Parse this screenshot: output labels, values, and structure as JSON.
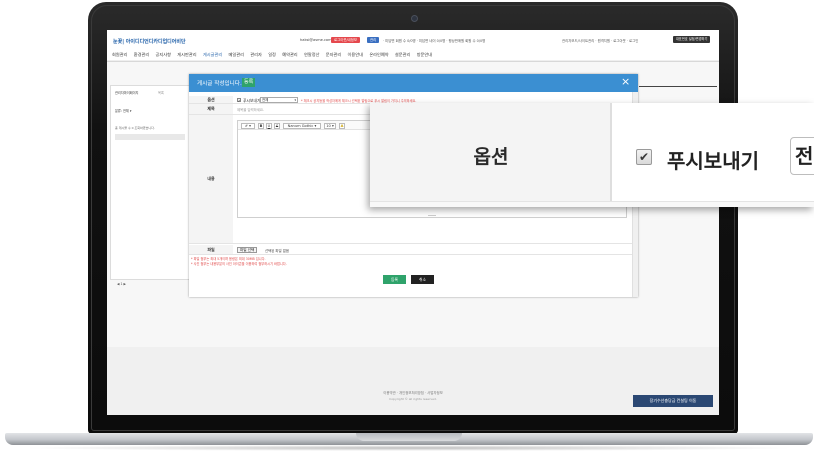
{
  "header": {
    "logo": "눈꽃| 아이디디언디카디업디어비단",
    "user_info": "haksi@asme.com",
    "logout_label": "로그아웃/내정보",
    "mode_label": "관리",
    "stats": "· 미답변 회원 수 0/0명 · 미답변 네이 0/0명 · 평상판매원 회원 수 0/0명",
    "util_links": "관리자모드/사이트관리 · 원격지원 · 로그아웃 · 로그인",
    "shortcut_label": "대표번호 설정/변경하기"
  },
  "nav": {
    "items": [
      "회원관리",
      "환경관리",
      "공지사항",
      "게시판관리",
      "게시글관리",
      "메일관리",
      "관리자",
      "일정",
      "예약관리",
      "연말정산",
      "문자관리",
      "이용안내",
      "온라인예약",
      "설문관리",
      "방문안내"
    ],
    "active_index": 4
  },
  "left_panel": {
    "tab1": "관리자마이페이지",
    "tab2": "목록",
    "select": "분류: 전체  ▾",
    "info": "총 게시물 수 0 조회하였습니다.",
    "pager": "◀ 1 ▶"
  },
  "modal": {
    "title": "게시글 작성입니다.",
    "badge": "등록",
    "close_icon": "×",
    "option_label": "옵션",
    "option_checkbox_label": "푸시보내기",
    "option_select_value": "전체",
    "option_notice": "* 체크시 공지등을 작성자에게 체크시 선택된 알림으로 푸시 알림이 가지니 주의하세요.",
    "title_label": "제목",
    "title_placeholder": "제목을 입력하세요.",
    "content_label": "내용",
    "toolbar": {
      "pen": "✐ ▾",
      "bold": "B",
      "underline": "U",
      "strike": "S",
      "font": "Nanum Gothic ▾",
      "size": "10 ▾",
      "color": "A"
    },
    "file_label": "파일",
    "file_button": "파일 선택",
    "file_none": "선택된 파일 없음",
    "notice1": "* 파일 첨부는 최대 5개이며 용량은 최대 30MB 입니다.",
    "notice2": "* 사진 첨부는 내용부분의 사진 아이콘을 이용하여 첨부하시기 바랍니다.",
    "register_label": "등록",
    "cancel_label": "취소"
  },
  "footer": {
    "links": "이용약관 · 개인정보처리방침 · 사업자정보",
    "copyright": "Copyright © all rights reserved.",
    "consult_label": "장기수선충당금 컨설팅 이동"
  },
  "zoom": {
    "label": "옵션",
    "checkbox_label": "푸시보내기",
    "select_partial": "전"
  }
}
